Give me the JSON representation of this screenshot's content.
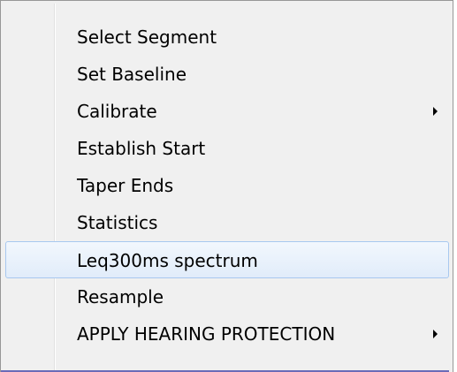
{
  "menu": {
    "items": [
      {
        "label": "Select Segment",
        "has_submenu": false
      },
      {
        "label": "Set Baseline",
        "has_submenu": false
      },
      {
        "label": "Calibrate",
        "has_submenu": true
      },
      {
        "label": "Establish Start",
        "has_submenu": false
      },
      {
        "label": "Taper Ends",
        "has_submenu": false
      },
      {
        "label": "Statistics",
        "has_submenu": false
      },
      {
        "label": "Leq300ms spectrum",
        "has_submenu": false,
        "highlighted": true
      },
      {
        "label": "Resample",
        "has_submenu": false
      },
      {
        "label": "APPLY HEARING PROTECTION",
        "has_submenu": true
      }
    ]
  },
  "colors": {
    "menu_background": "#f0f0f0",
    "highlight_border": "#a8c8ef",
    "highlight_fill": "#e1ecfa",
    "text": "#000000"
  }
}
